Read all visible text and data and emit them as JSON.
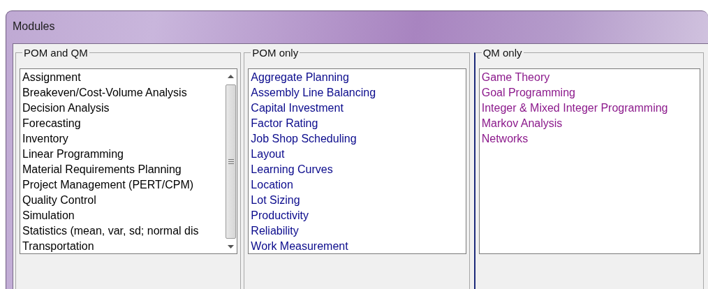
{
  "window": {
    "title": "Modules"
  },
  "groups": [
    {
      "label": "POM and QM",
      "color": "#000000",
      "scrollable": true,
      "items": [
        "Assignment",
        "Breakeven/Cost-Volume Analysis",
        "Decision Analysis",
        "Forecasting",
        "Inventory",
        "Linear Programming",
        "Material Requirements Planning",
        "Project Management (PERT/CPM)",
        "Quality Control",
        "Simulation",
        "Statistics (mean, var, sd; normal dis",
        "Transportation"
      ]
    },
    {
      "label": "POM only",
      "color": "#0a0a8c",
      "scrollable": false,
      "items": [
        "Aggregate Planning",
        "Assembly Line Balancing",
        "Capital Investment",
        "Factor Rating",
        "Job Shop Scheduling",
        "Layout",
        "Learning Curves",
        "Location",
        "Lot Sizing",
        "Productivity",
        "Reliability",
        "Work Measurement"
      ]
    },
    {
      "label": "QM only",
      "color": "#8c1a8c",
      "scrollable": false,
      "items": [
        "Game Theory",
        "Goal Programming",
        "Integer & Mixed Integer Programming",
        "Markov Analysis",
        "Networks"
      ]
    }
  ]
}
